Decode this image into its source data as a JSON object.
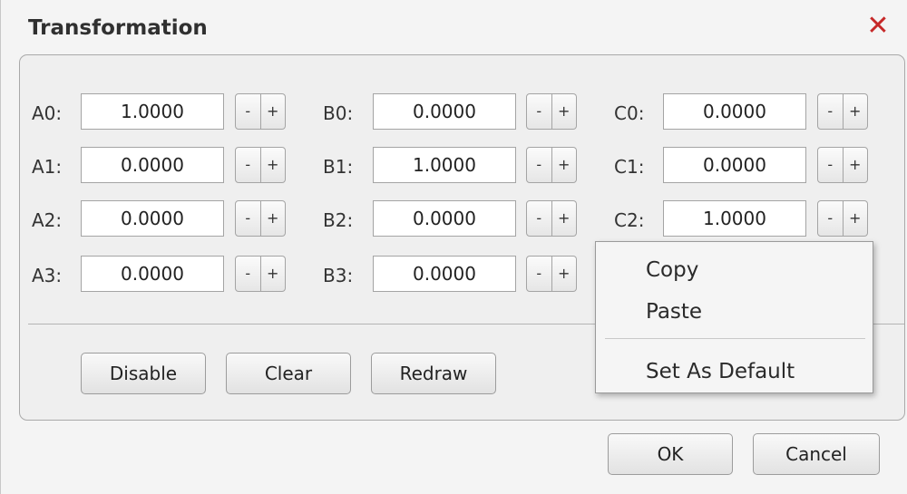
{
  "dialog": {
    "title": "Transformation",
    "close_glyph": "✕"
  },
  "rows": [
    {
      "a_label": "A0:",
      "a_value": "1.0000",
      "b_label": "B0:",
      "b_value": "0.0000",
      "c_label": "C0:",
      "c_value": "0.0000"
    },
    {
      "a_label": "A1:",
      "a_value": "0.0000",
      "b_label": "B1:",
      "b_value": "1.0000",
      "c_label": "C1:",
      "c_value": "0.0000"
    },
    {
      "a_label": "A2:",
      "a_value": "0.0000",
      "b_label": "B2:",
      "b_value": "0.0000",
      "c_label": "C2:",
      "c_value": "1.0000"
    },
    {
      "a_label": "A3:",
      "a_value": "0.0000",
      "b_label": "B3:",
      "b_value": "0.0000"
    }
  ],
  "stepper": {
    "minus": "-",
    "plus": "+"
  },
  "actions": {
    "disable": "Disable",
    "clear": "Clear",
    "redraw": "Redraw"
  },
  "footer": {
    "ok": "OK",
    "cancel": "Cancel"
  },
  "context_menu": {
    "copy": "Copy",
    "paste": "Paste",
    "set_default": "Set As Default"
  },
  "colors": {
    "close": "#c62828",
    "dialog_bg": "#f4f4f4",
    "panel_border": "#a9a9a9"
  }
}
